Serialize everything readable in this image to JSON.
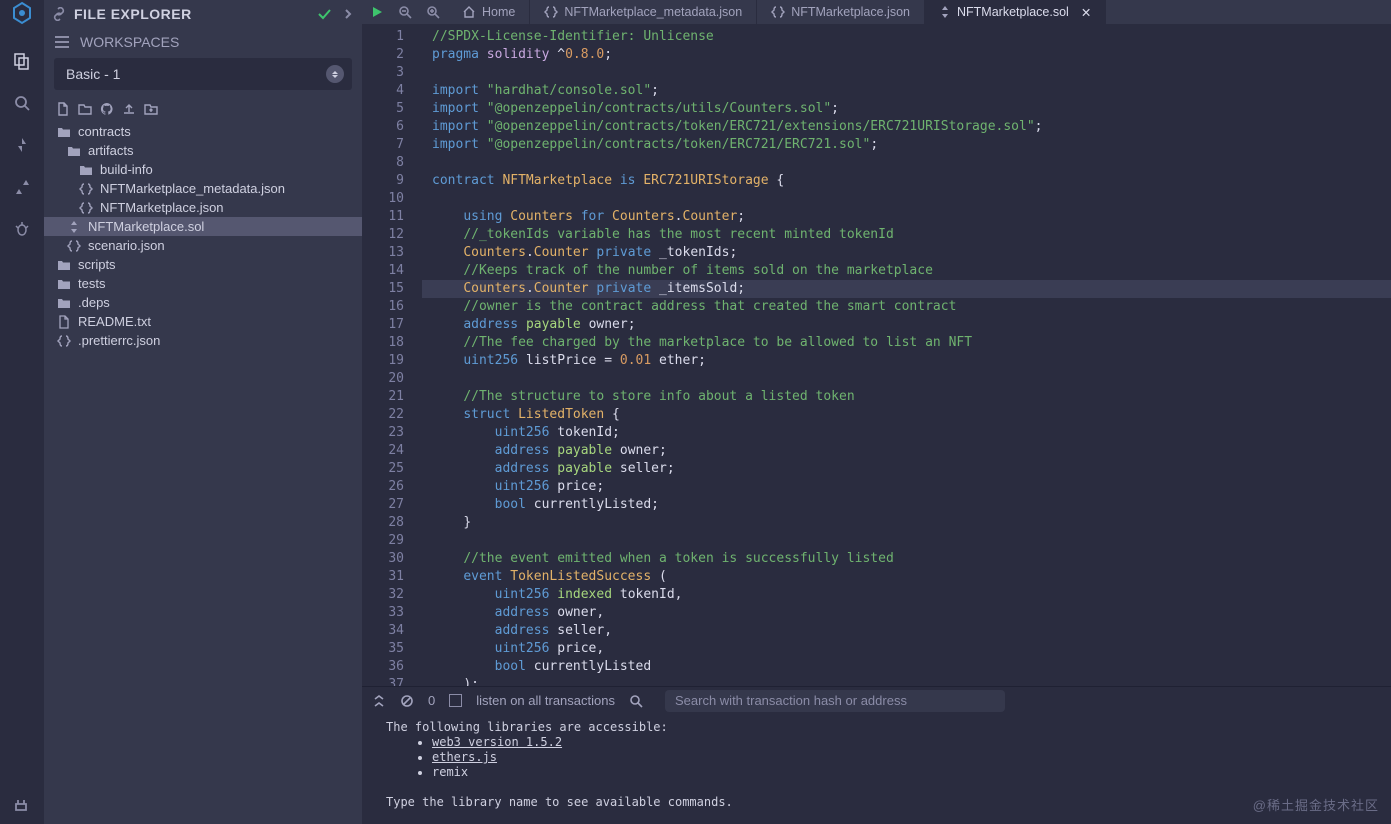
{
  "sidebar": {
    "title": "FILE EXPLORER",
    "workspaces_label": "WORKSPACES",
    "workspace_selected": "Basic - 1",
    "tree": [
      {
        "depth": 0,
        "icon": "folder-open",
        "label": "contracts"
      },
      {
        "depth": 1,
        "icon": "folder-open",
        "label": "artifacts"
      },
      {
        "depth": 2,
        "icon": "folder",
        "label": "build-info"
      },
      {
        "depth": 2,
        "icon": "braces",
        "label": "NFTMarketplace_metadata.json"
      },
      {
        "depth": 2,
        "icon": "braces",
        "label": "NFTMarketplace.json"
      },
      {
        "depth": 1,
        "icon": "solidity",
        "label": "NFTMarketplace.sol",
        "selected": true
      },
      {
        "depth": 1,
        "icon": "braces",
        "label": "scenario.json"
      },
      {
        "depth": 0,
        "icon": "folder",
        "label": "scripts"
      },
      {
        "depth": 0,
        "icon": "folder",
        "label": "tests"
      },
      {
        "depth": 0,
        "icon": "folder",
        "label": ".deps"
      },
      {
        "depth": 0,
        "icon": "file",
        "label": "README.txt"
      },
      {
        "depth": 0,
        "icon": "braces",
        "label": ".prettierrc.json"
      }
    ]
  },
  "tabs": {
    "items": [
      {
        "icon": "home",
        "label": "Home",
        "active": false
      },
      {
        "icon": "braces",
        "label": "NFTMarketplace_metadata.json",
        "active": false
      },
      {
        "icon": "braces",
        "label": "NFTMarketplace.json",
        "active": false
      },
      {
        "icon": "solidity",
        "label": "NFTMarketplace.sol",
        "active": true,
        "close": true
      }
    ]
  },
  "editor": {
    "current_line": 15,
    "lines": [
      [
        [
          "cm",
          "//SPDX-License-Identifier: Unlicense"
        ]
      ],
      [
        [
          "kw",
          "pragma"
        ],
        [
          "txt",
          " "
        ],
        [
          "fn",
          "solidity"
        ],
        [
          "txt",
          " "
        ],
        [
          "op",
          "^"
        ],
        [
          "num",
          "0.8.0"
        ],
        [
          "op",
          ";"
        ]
      ],
      [],
      [
        [
          "kw",
          "import"
        ],
        [
          "txt",
          " "
        ],
        [
          "str",
          "\"hardhat/console.sol\""
        ],
        [
          "op",
          ";"
        ]
      ],
      [
        [
          "kw",
          "import"
        ],
        [
          "txt",
          " "
        ],
        [
          "str",
          "\"@openzeppelin/contracts/utils/Counters.sol\""
        ],
        [
          "op",
          ";"
        ]
      ],
      [
        [
          "kw",
          "import"
        ],
        [
          "txt",
          " "
        ],
        [
          "str",
          "\"@openzeppelin/contracts/token/ERC721/extensions/ERC721URIStorage.sol\""
        ],
        [
          "op",
          ";"
        ]
      ],
      [
        [
          "kw",
          "import"
        ],
        [
          "txt",
          " "
        ],
        [
          "str",
          "\"@openzeppelin/contracts/token/ERC721/ERC721.sol\""
        ],
        [
          "op",
          ";"
        ]
      ],
      [],
      [
        [
          "kw",
          "contract"
        ],
        [
          "txt",
          " "
        ],
        [
          "id",
          "NFTMarketplace"
        ],
        [
          "txt",
          " "
        ],
        [
          "kw",
          "is"
        ],
        [
          "txt",
          " "
        ],
        [
          "id",
          "ERC721URIStorage"
        ],
        [
          "txt",
          " "
        ],
        [
          "op",
          "{"
        ]
      ],
      [],
      [
        [
          "txt",
          "    "
        ],
        [
          "kw",
          "using"
        ],
        [
          "txt",
          " "
        ],
        [
          "id",
          "Counters"
        ],
        [
          "txt",
          " "
        ],
        [
          "kw",
          "for"
        ],
        [
          "txt",
          " "
        ],
        [
          "id",
          "Counters"
        ],
        [
          "op",
          "."
        ],
        [
          "id",
          "Counter"
        ],
        [
          "op",
          ";"
        ]
      ],
      [
        [
          "txt",
          "    "
        ],
        [
          "cm",
          "//_tokenIds variable has the most recent minted tokenId"
        ]
      ],
      [
        [
          "txt",
          "    "
        ],
        [
          "id",
          "Counters"
        ],
        [
          "op",
          "."
        ],
        [
          "id",
          "Counter"
        ],
        [
          "txt",
          " "
        ],
        [
          "kw",
          "private"
        ],
        [
          "txt",
          " "
        ],
        [
          "txt",
          "_tokenIds"
        ],
        [
          "op",
          ";"
        ]
      ],
      [
        [
          "txt",
          "    "
        ],
        [
          "cm",
          "//Keeps track of the number of items sold on the marketplace"
        ]
      ],
      [
        [
          "txt",
          "    "
        ],
        [
          "id",
          "Counters"
        ],
        [
          "op",
          "."
        ],
        [
          "id",
          "Counter"
        ],
        [
          "txt",
          " "
        ],
        [
          "kw",
          "private"
        ],
        [
          "txt",
          " "
        ],
        [
          "txt",
          "_itemsSold"
        ],
        [
          "op",
          ";"
        ]
      ],
      [
        [
          "txt",
          "    "
        ],
        [
          "cm",
          "//owner is the contract address that created the smart contract"
        ]
      ],
      [
        [
          "txt",
          "    "
        ],
        [
          "kw",
          "address"
        ],
        [
          "txt",
          " "
        ],
        [
          "pay",
          "payable"
        ],
        [
          "txt",
          " "
        ],
        [
          "txt",
          "owner"
        ],
        [
          "op",
          ";"
        ]
      ],
      [
        [
          "txt",
          "    "
        ],
        [
          "cm",
          "//The fee charged by the marketplace to be allowed to list an NFT"
        ]
      ],
      [
        [
          "txt",
          "    "
        ],
        [
          "kw",
          "uint256"
        ],
        [
          "txt",
          " "
        ],
        [
          "txt",
          "listPrice"
        ],
        [
          "txt",
          " "
        ],
        [
          "op",
          "="
        ],
        [
          "txt",
          " "
        ],
        [
          "num",
          "0.01"
        ],
        [
          "txt",
          " "
        ],
        [
          "txt",
          "ether"
        ],
        [
          "op",
          ";"
        ]
      ],
      [],
      [
        [
          "txt",
          "    "
        ],
        [
          "cm",
          "//The structure to store info about a listed token"
        ]
      ],
      [
        [
          "txt",
          "    "
        ],
        [
          "kw",
          "struct"
        ],
        [
          "txt",
          " "
        ],
        [
          "id",
          "ListedToken"
        ],
        [
          "txt",
          " "
        ],
        [
          "op",
          "{"
        ]
      ],
      [
        [
          "txt",
          "        "
        ],
        [
          "kw",
          "uint256"
        ],
        [
          "txt",
          " "
        ],
        [
          "txt",
          "tokenId"
        ],
        [
          "op",
          ";"
        ]
      ],
      [
        [
          "txt",
          "        "
        ],
        [
          "kw",
          "address"
        ],
        [
          "txt",
          " "
        ],
        [
          "pay",
          "payable"
        ],
        [
          "txt",
          " "
        ],
        [
          "txt",
          "owner"
        ],
        [
          "op",
          ";"
        ]
      ],
      [
        [
          "txt",
          "        "
        ],
        [
          "kw",
          "address"
        ],
        [
          "txt",
          " "
        ],
        [
          "pay",
          "payable"
        ],
        [
          "txt",
          " "
        ],
        [
          "txt",
          "seller"
        ],
        [
          "op",
          ";"
        ]
      ],
      [
        [
          "txt",
          "        "
        ],
        [
          "kw",
          "uint256"
        ],
        [
          "txt",
          " "
        ],
        [
          "txt",
          "price"
        ],
        [
          "op",
          ";"
        ]
      ],
      [
        [
          "txt",
          "        "
        ],
        [
          "kw",
          "bool"
        ],
        [
          "txt",
          " "
        ],
        [
          "txt",
          "currentlyListed"
        ],
        [
          "op",
          ";"
        ]
      ],
      [
        [
          "txt",
          "    "
        ],
        [
          "op",
          "}"
        ]
      ],
      [],
      [
        [
          "txt",
          "    "
        ],
        [
          "cm",
          "//the event emitted when a token is successfully listed"
        ]
      ],
      [
        [
          "txt",
          "    "
        ],
        [
          "kw",
          "event"
        ],
        [
          "txt",
          " "
        ],
        [
          "id",
          "TokenListedSuccess"
        ],
        [
          "txt",
          " "
        ],
        [
          "op",
          "("
        ]
      ],
      [
        [
          "txt",
          "        "
        ],
        [
          "kw",
          "uint256"
        ],
        [
          "txt",
          " "
        ],
        [
          "pay",
          "indexed"
        ],
        [
          "txt",
          " "
        ],
        [
          "txt",
          "tokenId"
        ],
        [
          "op",
          ","
        ]
      ],
      [
        [
          "txt",
          "        "
        ],
        [
          "kw",
          "address"
        ],
        [
          "txt",
          " "
        ],
        [
          "txt",
          "owner"
        ],
        [
          "op",
          ","
        ]
      ],
      [
        [
          "txt",
          "        "
        ],
        [
          "kw",
          "address"
        ],
        [
          "txt",
          " "
        ],
        [
          "txt",
          "seller"
        ],
        [
          "op",
          ","
        ]
      ],
      [
        [
          "txt",
          "        "
        ],
        [
          "kw",
          "uint256"
        ],
        [
          "txt",
          " "
        ],
        [
          "txt",
          "price"
        ],
        [
          "op",
          ","
        ]
      ],
      [
        [
          "txt",
          "        "
        ],
        [
          "kw",
          "bool"
        ],
        [
          "txt",
          " "
        ],
        [
          "txt",
          "currentlyListed"
        ]
      ],
      [
        [
          "txt",
          "    "
        ],
        [
          "op",
          ")"
        ],
        [
          "op",
          ";"
        ]
      ]
    ]
  },
  "terminal_bar": {
    "count": "0",
    "listen_label": "listen on all transactions",
    "search_placeholder": "Search with transaction hash or address"
  },
  "terminal": {
    "line1": "The following libraries are accessible:",
    "libs": [
      "web3 version 1.5.2",
      "ethers.js",
      "remix"
    ],
    "line2": "Type the library name to see available commands."
  },
  "watermark": "@稀土掘金技术社区"
}
